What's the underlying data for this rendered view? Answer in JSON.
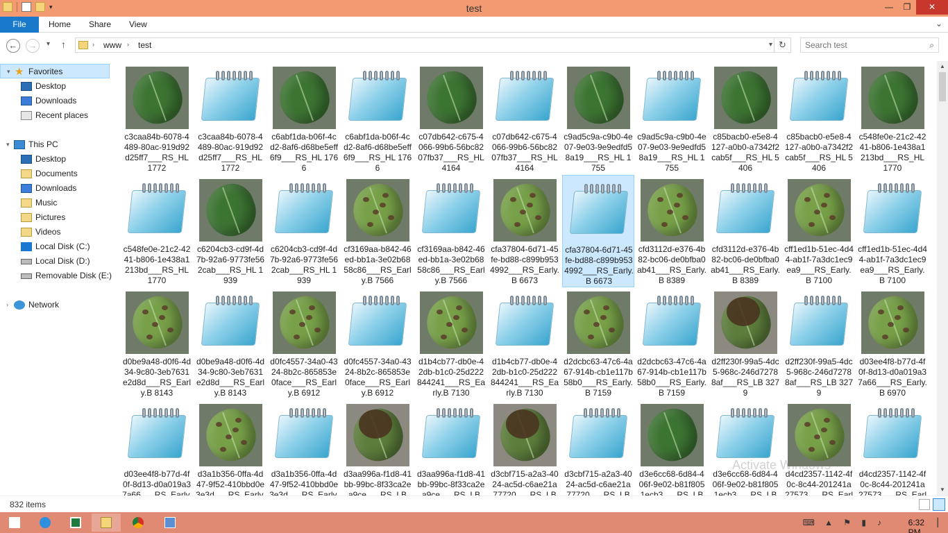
{
  "window": {
    "title": "test"
  },
  "qat": {
    "icons": [
      "properties-icon",
      "new-folder-icon",
      "customize-qat-icon"
    ]
  },
  "ribbon": {
    "tabs": [
      {
        "label": "File"
      },
      {
        "label": "Home"
      },
      {
        "label": "Share"
      },
      {
        "label": "View"
      }
    ]
  },
  "address": {
    "crumbs": [
      "www",
      "test"
    ]
  },
  "search": {
    "placeholder": "Search test"
  },
  "nav": {
    "favorites": "Favorites",
    "fav_items": [
      "Desktop",
      "Downloads",
      "Recent places"
    ],
    "this_pc": "This PC",
    "pc_items": [
      "Desktop",
      "Documents",
      "Downloads",
      "Music",
      "Pictures",
      "Videos",
      "Local Disk (C:)",
      "Local Disk (D:)",
      "Removable Disk (E:)"
    ],
    "network": "Network"
  },
  "files": [
    {
      "name": "c3caa84b-6078-4489-80ac-919d92d25ff7___RS_HL 1772",
      "kind": "leaf-healthy"
    },
    {
      "name": "c3caa84b-6078-4489-80ac-919d92d25ff7___RS_HL 1772",
      "kind": "note"
    },
    {
      "name": "c6abf1da-b06f-4cd2-8af6-d68be5eff6f9___RS_HL 1766",
      "kind": "leaf-healthy"
    },
    {
      "name": "c6abf1da-b06f-4cd2-8af6-d68be5eff6f9___RS_HL 1766",
      "kind": "note"
    },
    {
      "name": "c07db642-c675-4066-99b6-56bc8207fb37___RS_HL 4164",
      "kind": "leaf-healthy"
    },
    {
      "name": "c07db642-c675-4066-99b6-56bc8207fb37___RS_HL 4164",
      "kind": "note"
    },
    {
      "name": "c9ad5c9a-c9b0-4e07-9e03-9e9edfd58a19___RS_HL 1755",
      "kind": "leaf-healthy"
    },
    {
      "name": "c9ad5c9a-c9b0-4e07-9e03-9e9edfd58a19___RS_HL 1755",
      "kind": "note"
    },
    {
      "name": "c85bacb0-e5e8-4127-a0b0-a7342f2cab5f___RS_HL 5406",
      "kind": "leaf-healthy"
    },
    {
      "name": "c85bacb0-e5e8-4127-a0b0-a7342f2cab5f___RS_HL 5406",
      "kind": "note"
    },
    {
      "name": "c548fe0e-21c2-4241-b806-1e438a1213bd___RS_HL 1770",
      "kind": "leaf-healthy"
    },
    {
      "name": "c548fe0e-21c2-4241-b806-1e438a1213bd___RS_HL 1770",
      "kind": "note"
    },
    {
      "name": "c6204cb3-cd9f-4d7b-92a6-9773fe562cab___RS_HL 1939",
      "kind": "leaf-healthy"
    },
    {
      "name": "c6204cb3-cd9f-4d7b-92a6-9773fe562cab___RS_HL 1939",
      "kind": "note"
    },
    {
      "name": "cf3169aa-b842-46ed-bb1a-3e02b6858c86___RS_Early.B 7566",
      "kind": "leaf-early"
    },
    {
      "name": "cf3169aa-b842-46ed-bb1a-3e02b6858c86___RS_Early.B 7566",
      "kind": "note"
    },
    {
      "name": "cfa37804-6d71-45fe-bd88-c899b9534992___RS_Early.B 6673",
      "kind": "leaf-early"
    },
    {
      "name": "cfa37804-6d71-45fe-bd88-c899b9534992___RS_Early.B 6673",
      "kind": "note",
      "selected": true
    },
    {
      "name": "cfd3112d-e376-4b82-bc06-de0bfba0ab41___RS_Early.B 8389",
      "kind": "leaf-early"
    },
    {
      "name": "cfd3112d-e376-4b82-bc06-de0bfba0ab41___RS_Early.B 8389",
      "kind": "note"
    },
    {
      "name": "cff1ed1b-51ec-4d44-ab1f-7a3dc1ec9ea9___RS_Early.B 7100",
      "kind": "leaf-early"
    },
    {
      "name": "cff1ed1b-51ec-4d44-ab1f-7a3dc1ec9ea9___RS_Early.B 7100",
      "kind": "note"
    },
    {
      "name": "d0be9a48-d0f6-4d34-9c80-3eb7631e2d8d___RS_Early.B 8143",
      "kind": "leaf-early"
    },
    {
      "name": "d0be9a48-d0f6-4d34-9c80-3eb7631e2d8d___RS_Early.B 8143",
      "kind": "note"
    },
    {
      "name": "d0fc4557-34a0-4324-8b2c-865853e0face___RS_Early.B 6912",
      "kind": "leaf-early"
    },
    {
      "name": "d0fc4557-34a0-4324-8b2c-865853e0face___RS_Early.B 6912",
      "kind": "note"
    },
    {
      "name": "d1b4cb77-db0e-42db-b1c0-25d222844241___RS_Early.B 7130",
      "kind": "leaf-early"
    },
    {
      "name": "d1b4cb77-db0e-42db-b1c0-25d222844241___RS_Early.B 7130",
      "kind": "note"
    },
    {
      "name": "d2dcbc63-47c6-4a67-914b-cb1e117b58b0___RS_Early.B 7159",
      "kind": "leaf-early"
    },
    {
      "name": "d2dcbc63-47c6-4a67-914b-cb1e117b58b0___RS_Early.B 7159",
      "kind": "note"
    },
    {
      "name": "d2ff230f-99a5-4dc5-968c-246d72788af___RS_LB 3279",
      "kind": "leaf-late"
    },
    {
      "name": "d2ff230f-99a5-4dc5-968c-246d72788af___RS_LB 3279",
      "kind": "note"
    },
    {
      "name": "d03ee4f8-b77d-4f0f-8d13-d0a019a37a66___RS_Early.B 6970",
      "kind": "leaf-early"
    },
    {
      "name": "d03ee4f8-b77d-4f0f-8d13-d0a019a37a66___RS_Early.",
      "kind": "note"
    },
    {
      "name": "d3a1b356-0ffa-4d47-9f52-410bbd0e3e3d___RS_Early.",
      "kind": "leaf-early"
    },
    {
      "name": "d3a1b356-0ffa-4d47-9f52-410bbd0e3e3d___RS_Early.",
      "kind": "note"
    },
    {
      "name": "d3aa996a-f1d8-41bb-99bc-8f33ca2ea9ce___RS_LB",
      "kind": "leaf-late"
    },
    {
      "name": "d3aa996a-f1d8-41bb-99bc-8f33ca2ea9ce___RS_LB",
      "kind": "note"
    },
    {
      "name": "d3cbf715-a2a3-4024-ac5d-c6ae21a77720___RS_LB",
      "kind": "leaf-late"
    },
    {
      "name": "d3cbf715-a2a3-4024-ac5d-c6ae21a77720___RS_LB",
      "kind": "note"
    },
    {
      "name": "d3e6cc68-6d84-406f-9e02-b81f8051ecb3___RS_LB",
      "kind": "leaf-healthy"
    },
    {
      "name": "d3e6cc68-6d84-406f-9e02-b81f8051ecb3___RS_LB",
      "kind": "note"
    },
    {
      "name": "d4cd2357-1142-4f0c-8c44-201241a27573___RS_Early.",
      "kind": "leaf-early"
    },
    {
      "name": "d4cd2357-1142-4f0c-8c44-201241a27573___RS_Early.",
      "kind": "note"
    }
  ],
  "status": {
    "count": "832 items"
  },
  "watermark": "Activate Windows",
  "taskbar": {
    "apps": [
      "start-icon",
      "internet-explorer-icon",
      "excel-icon",
      "file-explorer-icon",
      "chrome-icon",
      "remote-desktop-icon"
    ],
    "time": "6:32 PM"
  },
  "colors": {
    "titlebar": "#f29a72",
    "file_tab": "#1979ca",
    "taskbar": "#e08a73",
    "selection": "#cce8ff"
  }
}
